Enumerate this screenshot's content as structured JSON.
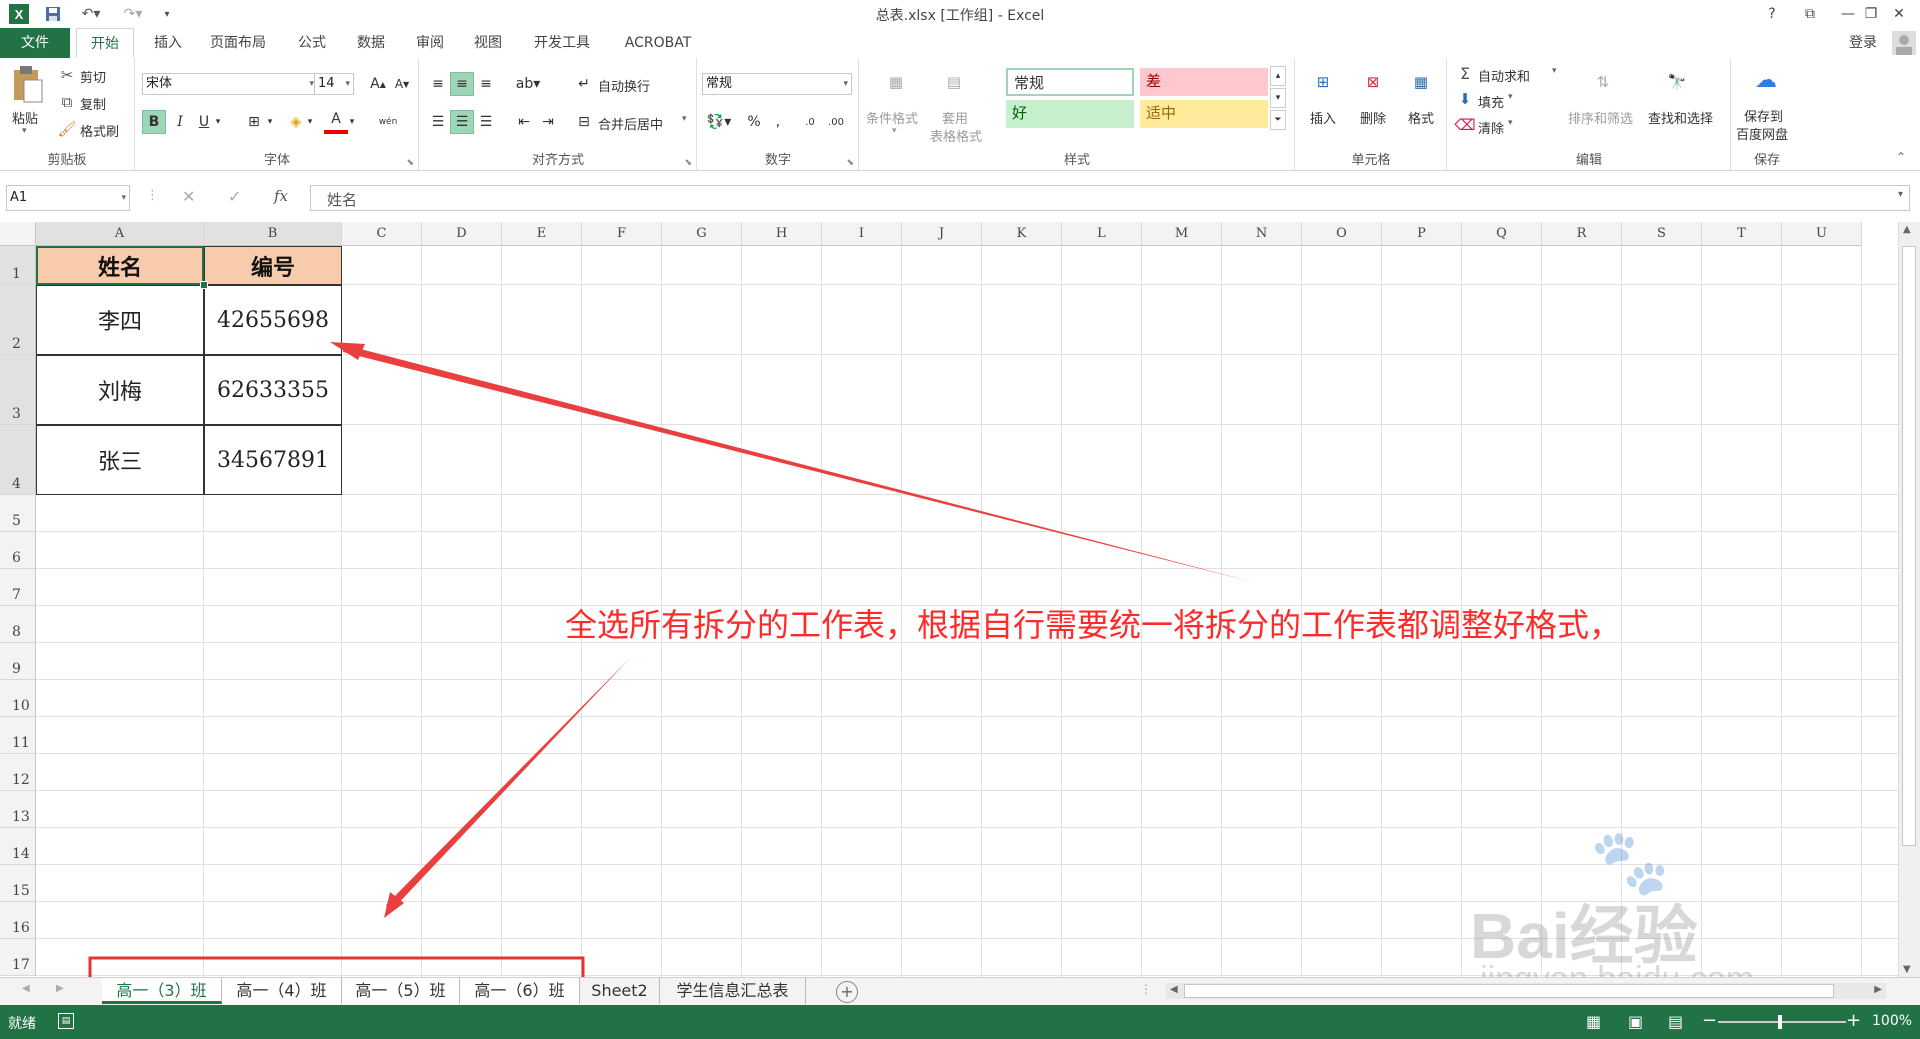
{
  "app": {
    "title": "总表.xlsx  [工作组] - Excel",
    "help": "?",
    "user": "登录"
  },
  "tabs": [
    "文件",
    "开始",
    "插入",
    "页面布局",
    "公式",
    "数据",
    "审阅",
    "视图",
    "开发工具",
    "ACROBAT"
  ],
  "ribbon": {
    "clipboard": {
      "label": "剪贴板",
      "paste": "粘贴",
      "cut": "剪切",
      "copy": "复制",
      "format_painter": "格式刷"
    },
    "font": {
      "label": "字体",
      "name": "宋体",
      "size": "14",
      "bold": "B",
      "italic": "I",
      "underline": "U",
      "font_color_icon": "A",
      "wen_icon": "wén"
    },
    "alignment": {
      "label": "对齐方式",
      "wrap": "自动换行",
      "merge": "合并后居中"
    },
    "number": {
      "label": "数字",
      "format": "常规"
    },
    "styles": {
      "label": "样式",
      "cond_format": "条件格式",
      "table_format_1": "套用",
      "table_format_2": "表格格式",
      "normal": "常规",
      "bad": "差",
      "good": "好",
      "neutral": "适中"
    },
    "cells": {
      "label": "单元格",
      "insert": "插入",
      "delete": "删除",
      "format": "格式"
    },
    "editing": {
      "label": "编辑",
      "autosum": "自动求和",
      "fill": "填充",
      "clear": "清除",
      "sort_filter": "排序和筛选",
      "find_select": "查找和选择"
    },
    "save": {
      "label": "保存",
      "save_to_1": "保存到",
      "save_to_2": "百度网盘"
    }
  },
  "formula_bar": {
    "name_box": "A1",
    "fx": "fx",
    "content": "姓名"
  },
  "columns": [
    "A",
    "B",
    "C",
    "D",
    "E",
    "F",
    "G",
    "H",
    "I",
    "J",
    "K",
    "L",
    "M",
    "N",
    "O",
    "P",
    "Q",
    "R",
    "S",
    "T",
    "U"
  ],
  "rows": [
    "1",
    "2",
    "3",
    "4",
    "5",
    "6",
    "7",
    "8",
    "9",
    "10",
    "11",
    "12",
    "13",
    "14",
    "15",
    "16",
    "17"
  ],
  "table": {
    "headers": [
      "姓名",
      "编号"
    ],
    "rows": [
      [
        "李四",
        "42655698"
      ],
      [
        "刘梅",
        "62633355"
      ],
      [
        "张三",
        "34567891"
      ]
    ]
  },
  "sheets": [
    "高一（3）班",
    "高一（4）班",
    "高一（5）班",
    "高一（6）班",
    "Sheet2",
    "学生信息汇总表"
  ],
  "status": {
    "ready": "就绪",
    "zoom": "100%"
  },
  "annotation": {
    "text": "全选所有拆分的工作表，根据自行需要统一将拆分的工作表都调整好格式，"
  },
  "watermark": {
    "brand": "Bai经验",
    "url": "jingyan.baidu.com"
  },
  "colors": {
    "excel_green": "#217346",
    "header_fill": "#f8cbad",
    "annotation_red": "#ff2a2a"
  }
}
